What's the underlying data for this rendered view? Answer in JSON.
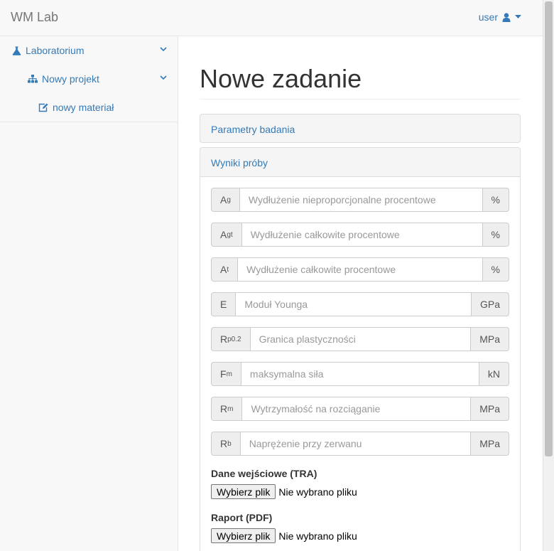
{
  "navbar": {
    "brand": "WM Lab",
    "user": "user"
  },
  "sidebar": {
    "items": [
      {
        "label": "Laboratorium",
        "icon": "flask-icon"
      },
      {
        "label": "Nowy projekt",
        "icon": "sitemap-icon"
      },
      {
        "label": "nowy materiał",
        "icon": "edit-icon"
      }
    ]
  },
  "main": {
    "title": "Nowe zadanie",
    "panel1": "Parametry badania",
    "panel2": "Wyniki próby",
    "fields": [
      {
        "sym": "A",
        "sub": "g",
        "placeholder": "Wydłużenie nieproporcjonalne procentowe",
        "unit": "%"
      },
      {
        "sym": "A",
        "sub": "gt",
        "placeholder": "Wydłużenie całkowite procentowe",
        "unit": "%"
      },
      {
        "sym": "A",
        "sub": "t",
        "placeholder": "Wydłużenie całkowite procentowe",
        "unit": "%"
      },
      {
        "sym": "E",
        "sub": "",
        "placeholder": "Moduł Younga",
        "unit": "GPa"
      },
      {
        "sym": "R",
        "sub": "p0.2",
        "placeholder": "Granica plastyczności",
        "unit": "MPa"
      },
      {
        "sym": "F",
        "sub": "m",
        "placeholder": "maksymalna siła",
        "unit": "kN"
      },
      {
        "sym": "R",
        "sub": "m",
        "placeholder": "Wytrzymałość na rozciąganie",
        "unit": "MPa"
      },
      {
        "sym": "R",
        "sub": "b",
        "placeholder": "Naprężenie przy zerwanu",
        "unit": "MPa"
      }
    ],
    "files": [
      {
        "label": "Dane wejściowe (TRA)",
        "button": "Wybierz plik",
        "status": "Nie wybrano pliku"
      },
      {
        "label": "Raport (PDF)",
        "button": "Wybierz plik",
        "status": "Nie wybrano pliku"
      }
    ]
  },
  "colors": {
    "link": "#337ab7",
    "navbar_bg": "#f8f8f8",
    "addon_bg": "#eeeeee"
  }
}
